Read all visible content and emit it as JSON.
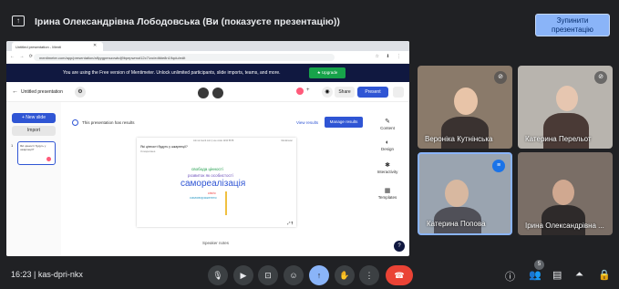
{
  "meet": {
    "presenter_title": "Ірина Олександрівна Лободовська (Ви (показуєте презентацію))",
    "stop_button": "Зупинити презентацію",
    "meeting_time": "16:23",
    "meeting_separator": "|",
    "meeting_code": "kas-dpri-nkx",
    "participants_count": "5",
    "participants": [
      {
        "name": "Вероніка Кутнінська",
        "muted": true
      },
      {
        "name": "Катерина Перельот",
        "muted": true
      },
      {
        "name": "Катерина Попова",
        "muted": false
      },
      {
        "name": "Ірина Олександрівна ...",
        "muted": false
      }
    ]
  },
  "browser": {
    "tab_title": "Untitled presentation - Menti",
    "url": "mentimeter.com/app/presentation/alfyygpmszcwkdj9bpepwmot12c7/zo/edit#e8n19qdu/edit",
    "banner_text": "You are using the Free version of Mentimeter. Unlock unlimited participants, slide imports, teams, and more.",
    "upgrade_label": "Upgrade"
  },
  "menti": {
    "presentation_name": "Untitled presentation",
    "share_label": "Share",
    "present_label": "Present",
    "new_slide_label": "+ New slide",
    "import_label": "Import",
    "thumb_number": "1",
    "thumb_text": "Які цінності будуть у шкарпеції?",
    "info_message": "This presentation has results",
    "view_results": "View results",
    "manage_results": "Manage results",
    "speaker_notes": "Speaker notes",
    "right_panel": [
      "Content",
      "Design",
      "Interactivity",
      "Templates"
    ],
    "slide": {
      "join_url": "Join at menti.com | use code 1234 5678",
      "brand": "Mentimeter",
      "question": "Які цінності будуть у шкарпеції?",
      "responses": "3 responses",
      "words": [
        "свобода цінності",
        "розвиток як особистості",
        "самореалізація",
        "сім'я",
        "самовираження"
      ]
    }
  }
}
